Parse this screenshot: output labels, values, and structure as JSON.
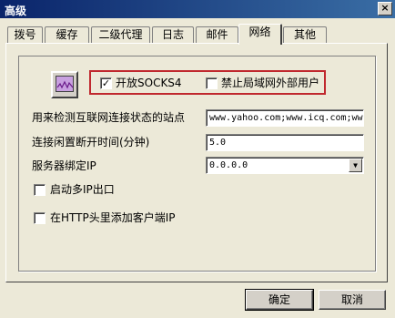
{
  "window": {
    "title": "高级",
    "close_glyph": "×"
  },
  "tabs": [
    "拨号",
    "缓存",
    "二级代理",
    "日志",
    "邮件",
    "网络",
    "其他"
  ],
  "active_tab": "网络",
  "options": {
    "enable_socks4": {
      "label": "开放SOCKS4",
      "checked": true
    },
    "block_lan_external": {
      "label": "禁止局域网外部用户",
      "checked": false
    }
  },
  "fields": {
    "check_sites": {
      "label": "用来检测互联网连接状态的站点",
      "value": "www.yahoo.com;www.icq.com;ww"
    },
    "idle_disconnect": {
      "label": "连接闲置断开时间(分钟)",
      "value": "5.0"
    },
    "bind_ip": {
      "label": "服务器绑定IP",
      "value": "0.0.0.0",
      "arrow": "▼"
    }
  },
  "checkboxes": {
    "multi_ip": {
      "label": "启动多IP出口",
      "checked": false
    },
    "add_client_header": {
      "label": "在HTTP头里添加客户端IP",
      "checked": false
    }
  },
  "buttons": {
    "ok": "确定",
    "cancel": "取消"
  },
  "colors": {
    "highlight_border": "#c0282e",
    "titlebar": "#0a246a"
  },
  "icons": {
    "network": "network-monitor-icon"
  }
}
